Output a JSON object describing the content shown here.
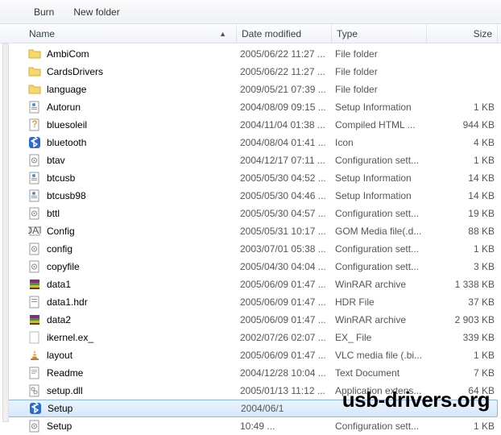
{
  "toolbar": {
    "burn": "Burn",
    "newFolder": "New folder"
  },
  "headers": {
    "name": "Name",
    "date": "Date modified",
    "type": "Type",
    "size": "Size"
  },
  "watermark": "usb-drivers.org",
  "files": [
    {
      "icon": "folder",
      "name": "AmbiCom",
      "date": "2005/06/22 11:27 ...",
      "type": "File folder",
      "size": ""
    },
    {
      "icon": "folder",
      "name": "CardsDrivers",
      "date": "2005/06/22 11:27 ...",
      "type": "File folder",
      "size": ""
    },
    {
      "icon": "folder",
      "name": "language",
      "date": "2009/05/21 07:39 ...",
      "type": "File folder",
      "size": ""
    },
    {
      "icon": "inf",
      "name": "Autorun",
      "date": "2004/08/09 09:15 ...",
      "type": "Setup Information",
      "size": "1 KB"
    },
    {
      "icon": "chm",
      "name": "bluesoleil",
      "date": "2004/11/04 01:38 ...",
      "type": "Compiled HTML ...",
      "size": "944 KB"
    },
    {
      "icon": "bt",
      "name": "bluetooth",
      "date": "2004/08/04 01:41 ...",
      "type": "Icon",
      "size": "4 KB"
    },
    {
      "icon": "cfg",
      "name": "btav",
      "date": "2004/12/17 07:11 ...",
      "type": "Configuration sett...",
      "size": "1 KB"
    },
    {
      "icon": "inf",
      "name": "btcusb",
      "date": "2005/05/30 04:52 ...",
      "type": "Setup Information",
      "size": "14 KB"
    },
    {
      "icon": "inf",
      "name": "btcusb98",
      "date": "2005/05/30 04:46 ...",
      "type": "Setup Information",
      "size": "14 KB"
    },
    {
      "icon": "cfg",
      "name": "bttl",
      "date": "2005/05/30 04:57 ...",
      "type": "Configuration sett...",
      "size": "19 KB"
    },
    {
      "icon": "dat",
      "name": "Config",
      "date": "2005/05/31 10:17 ...",
      "type": "GOM Media file(.d...",
      "size": "88 KB"
    },
    {
      "icon": "cfg",
      "name": "config",
      "date": "2003/07/01 05:38 ...",
      "type": "Configuration sett...",
      "size": "1 KB"
    },
    {
      "icon": "cfg",
      "name": "copyfile",
      "date": "2005/04/30 04:04 ...",
      "type": "Configuration sett...",
      "size": "3 KB"
    },
    {
      "icon": "rar",
      "name": "data1",
      "date": "2005/06/09 01:47 ...",
      "type": "WinRAR archive",
      "size": "1 338 KB"
    },
    {
      "icon": "hdr",
      "name": "data1.hdr",
      "date": "2005/06/09 01:47 ...",
      "type": "HDR File",
      "size": "37 KB"
    },
    {
      "icon": "rar",
      "name": "data2",
      "date": "2005/06/09 01:47 ...",
      "type": "WinRAR archive",
      "size": "2 903 KB"
    },
    {
      "icon": "blank",
      "name": "ikernel.ex_",
      "date": "2002/07/26 02:07 ...",
      "type": "EX_ File",
      "size": "339 KB"
    },
    {
      "icon": "vlc",
      "name": "layout",
      "date": "2005/06/09 01:47 ...",
      "type": "VLC media file (.bi...",
      "size": "1 KB"
    },
    {
      "icon": "txt",
      "name": "Readme",
      "date": "2004/12/28 10:04 ...",
      "type": "Text Document",
      "size": "7 KB"
    },
    {
      "icon": "dll",
      "name": "setup.dll",
      "date": "2005/01/13 11:12 ...",
      "type": "Application extens...",
      "size": "64 KB"
    },
    {
      "icon": "bt",
      "name": "Setup",
      "date": "2004/06/1",
      "type": "",
      "size": "",
      "selected": true
    },
    {
      "icon": "cfg",
      "name": "Setup",
      "date": "10:49 ...",
      "type": "Configuration sett...",
      "size": "1 KB"
    }
  ]
}
